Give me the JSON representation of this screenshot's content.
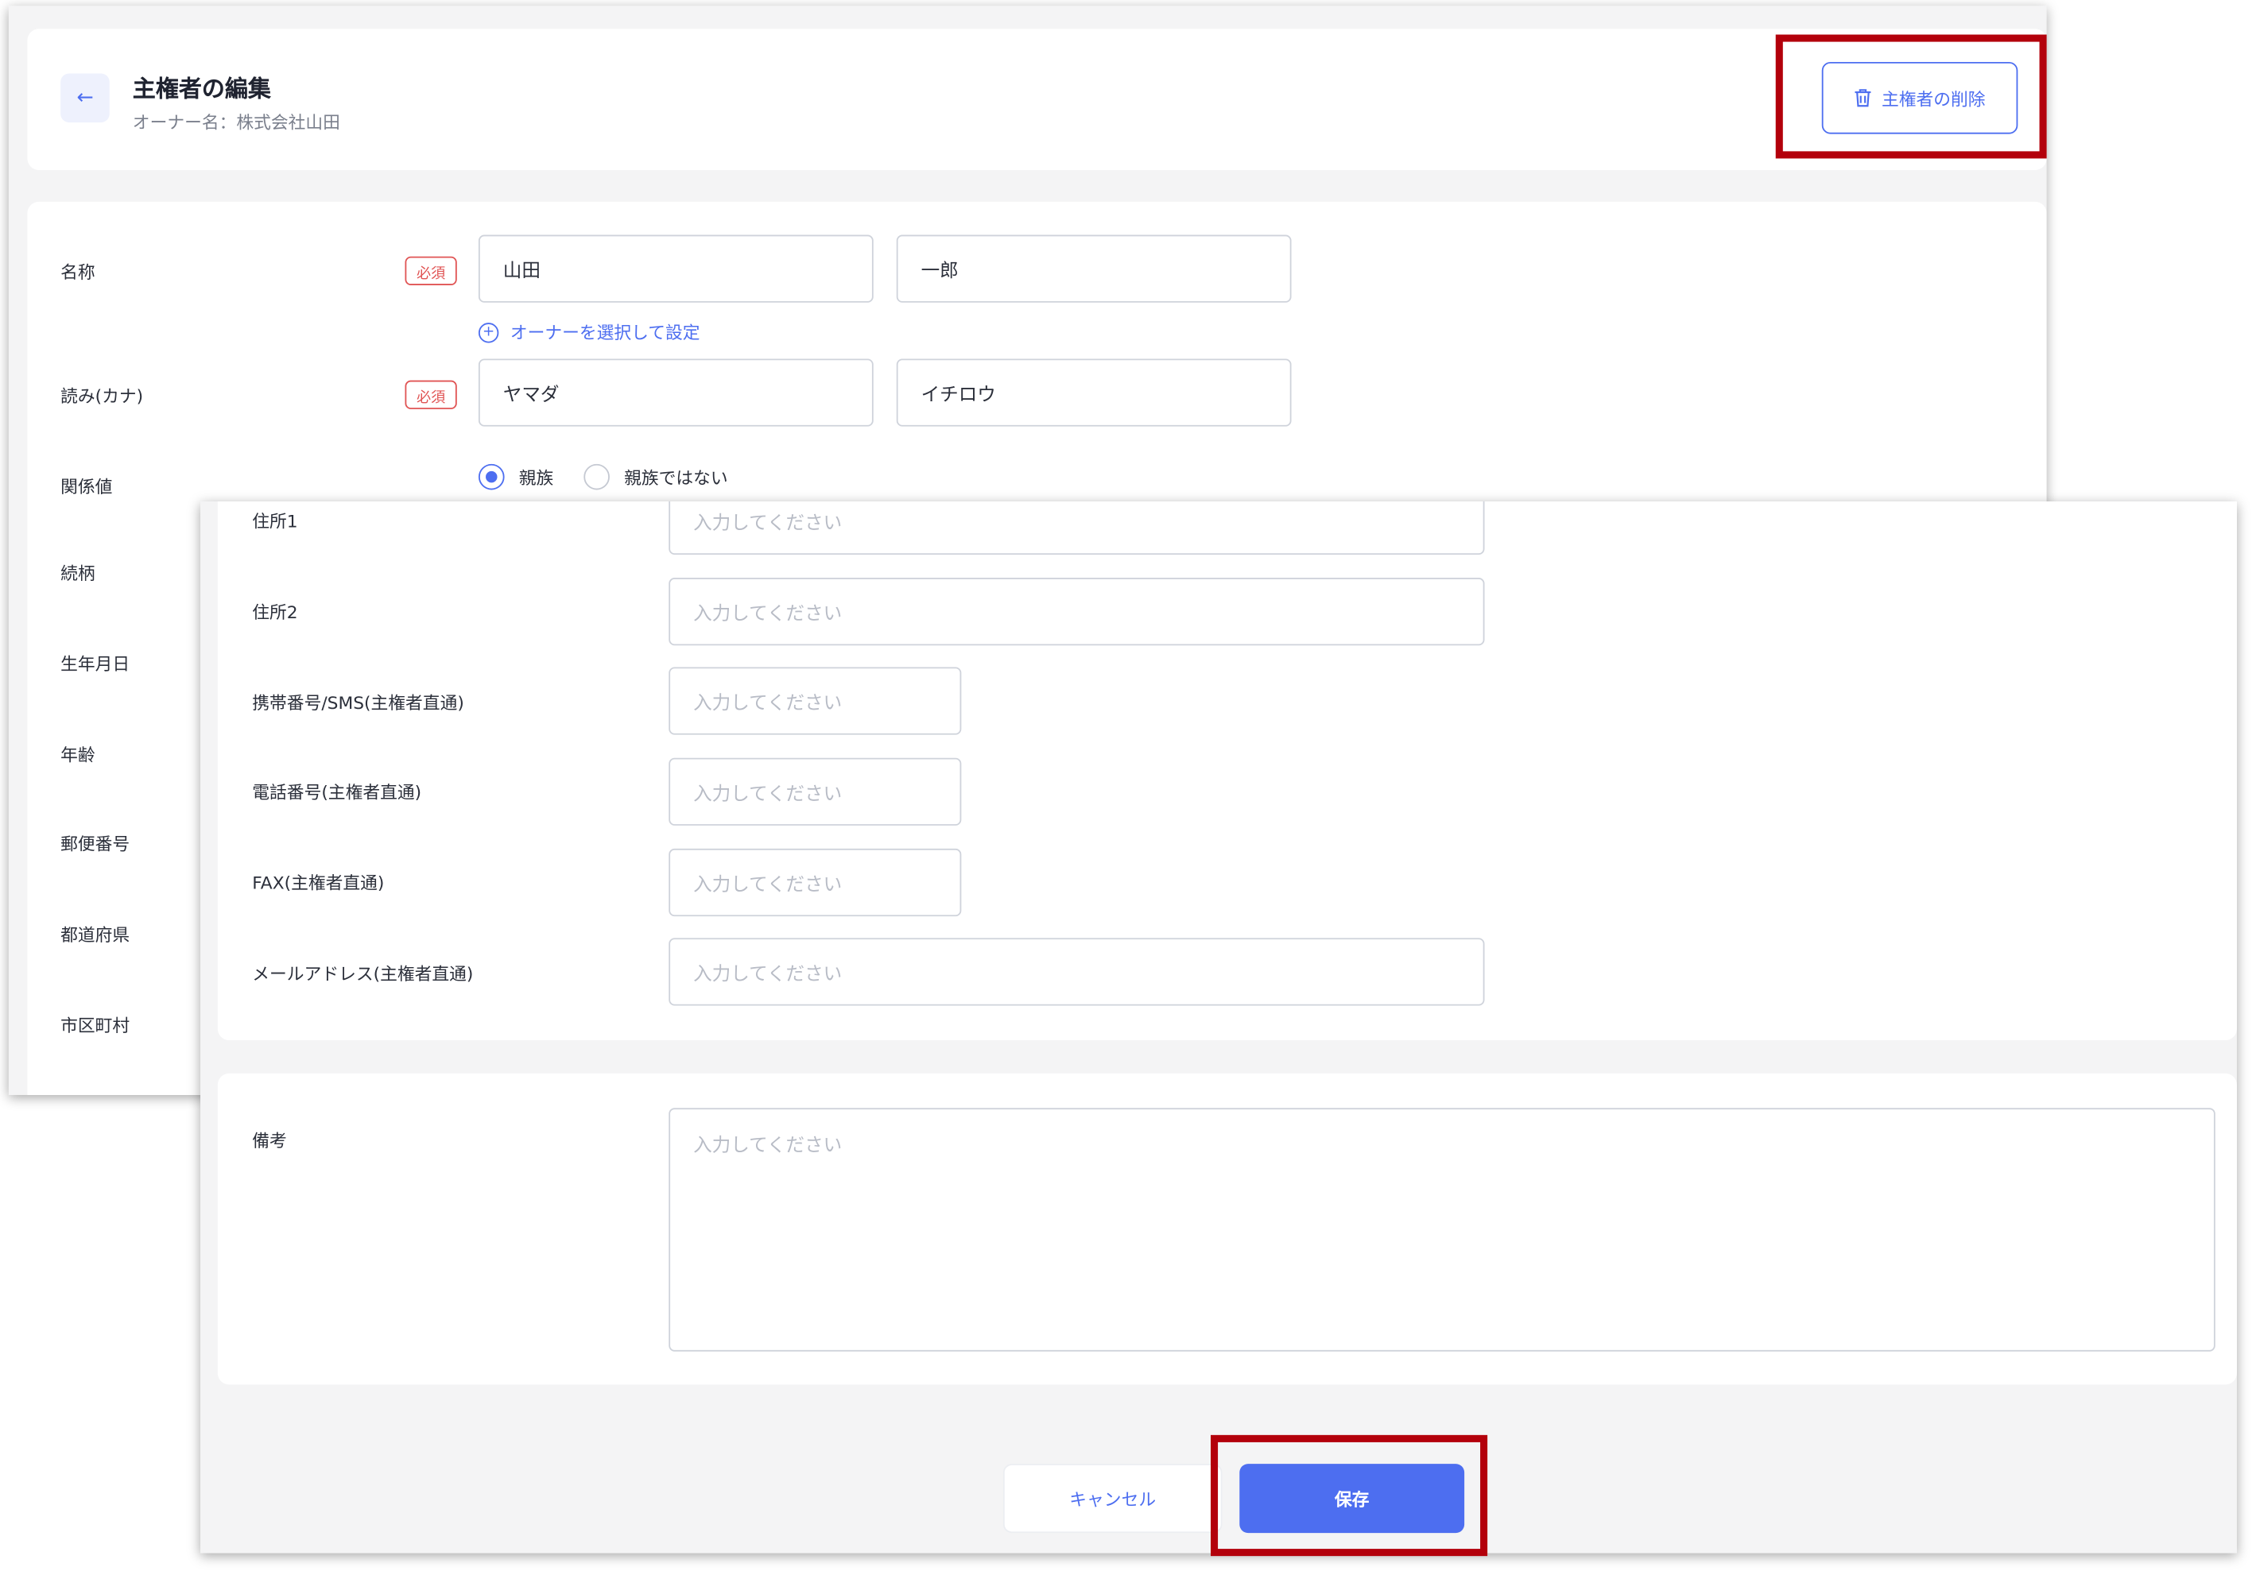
{
  "header": {
    "back_icon": "arrow-left-icon",
    "title": "主権者の編集",
    "subtitle": "オーナー名：株式会社山田",
    "delete_label": "主権者の削除",
    "delete_icon": "trash-icon"
  },
  "form_top": {
    "name_label": "名称",
    "required_badge": "必須",
    "last_name": "山田",
    "first_name": "一郎",
    "owner_link": "オーナーを選択して設定",
    "kana_label": "読み(カナ)",
    "last_kana": "ヤマダ",
    "first_kana": "イチロウ",
    "relation_label": "関係値",
    "relation_options": [
      "親族",
      "親族ではない"
    ],
    "relation_selected": "親族",
    "side_labels": [
      "続柄",
      "生年月日",
      "年齢",
      "郵便番号",
      "都道府県",
      "市区町村"
    ]
  },
  "form_bottom": {
    "placeholder": "入力してください",
    "address1_label": "住所1",
    "address2_label": "住所2",
    "mobile_label": "携帯番号/SMS(主権者直通)",
    "phone_label": "電話番号(主権者直通)",
    "fax_label": "FAX(主権者直通)",
    "email_label": "メールアドレス(主権者直通)",
    "notes_label": "備考"
  },
  "footer": {
    "cancel_label": "キャンセル",
    "save_label": "保存"
  },
  "colors": {
    "accent": "#4d6ef0",
    "required": "#e05454",
    "highlight": "#b3000b"
  }
}
